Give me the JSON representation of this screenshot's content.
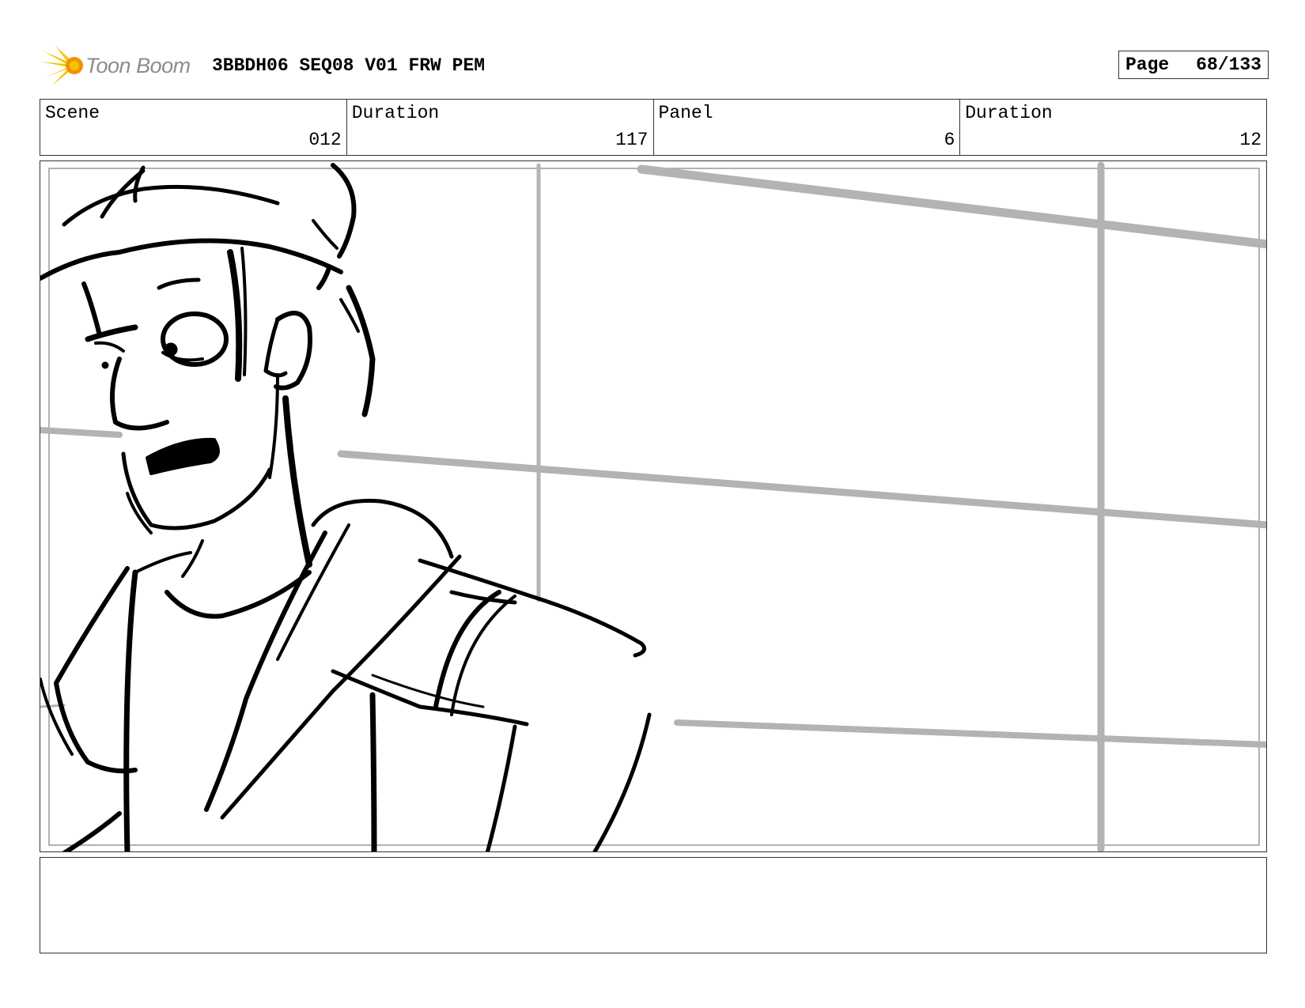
{
  "header": {
    "logo_text": "Toon Boom",
    "project_title": "3BBDH06 SEQ08 V01 FRW PEM",
    "page_label": "Page",
    "page_number": "68/133"
  },
  "info": {
    "scene_label": "Scene",
    "scene_value": "012",
    "scene_duration_label": "Duration",
    "scene_duration_value": "117",
    "panel_label": "Panel",
    "panel_value": "6",
    "panel_duration_label": "Duration",
    "panel_duration_value": "12"
  },
  "panel": {
    "image": "storyboard-sketch-character-looking-left-grid-window-background"
  },
  "notes": {
    "text": ""
  },
  "colors": {
    "logo_yellow": "#f5c400",
    "logo_orange": "#f39200",
    "grid_gray": "#b3b3b3",
    "ink": "#000000"
  }
}
